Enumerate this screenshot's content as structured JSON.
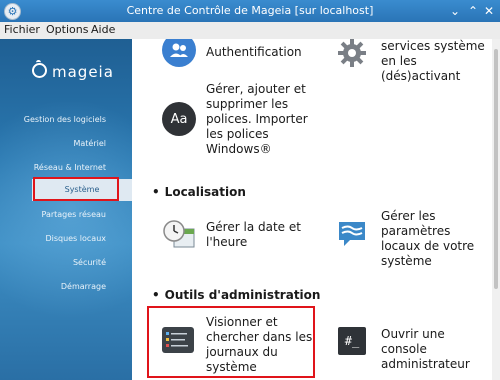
{
  "window": {
    "title": "Centre de Contrôle de Mageia [sur localhost]",
    "controls": {
      "minimize": "⌄",
      "maximize": "⌃",
      "close": "✕"
    }
  },
  "menubar": {
    "items": [
      "Fichier",
      "Options",
      "Aide"
    ]
  },
  "sidebar": {
    "logo_text": "mageia",
    "items": [
      {
        "label": "Gestion des logiciels"
      },
      {
        "label": "Matériel"
      },
      {
        "label": "Réseau & Internet"
      },
      {
        "label": "Système",
        "selected": true
      },
      {
        "label": "Partages réseau"
      },
      {
        "label": "Disques locaux"
      },
      {
        "label": "Sécurité"
      },
      {
        "label": "Démarrage"
      }
    ]
  },
  "main": {
    "items": {
      "authentification": {
        "label": "Authentification",
        "icon": "users-icon"
      },
      "services": {
        "label": "Gérer les services système en les (dés)activant",
        "icon": "gear-icon"
      },
      "polices": {
        "label": "Gérer, ajouter et supprimer les polices. Importer les polices Windows®",
        "icon": "font-icon"
      },
      "date": {
        "label": "Gérer la date et l'heure",
        "icon": "clock-calendar-icon"
      },
      "locaux": {
        "label": "Gérer les paramètres locaux de votre système",
        "icon": "flag-icon"
      },
      "journaux": {
        "label": "Visionner et chercher dans les journaux du système",
        "icon": "log-viewer-icon"
      },
      "console": {
        "label": "Ouvrir une console administrateur",
        "icon": "terminal-icon"
      }
    },
    "sections": {
      "localisation": "Localisation",
      "outils": "Outils d'administration"
    },
    "bullet": "•"
  },
  "colors": {
    "titlebar": "#2a74b6",
    "sidebar": "#2a78b0",
    "highlight": "#e0141a"
  }
}
